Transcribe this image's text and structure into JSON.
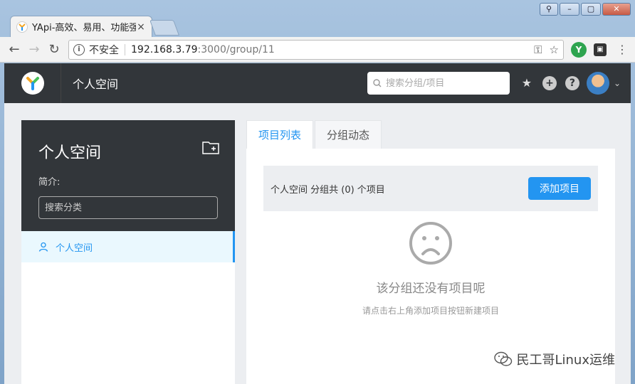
{
  "browser": {
    "tab_title": "YApi-高效、易用、功能强",
    "insecure_label": "不安全",
    "url_host": "192.168.3.79",
    "url_rest": ":3000/group/11",
    "ext_green": "Y"
  },
  "header": {
    "title": "个人空间",
    "search_placeholder": "搜索分组/项目"
  },
  "sidebar": {
    "group_name": "个人空间",
    "intro_label": "简介:",
    "category_search_placeholder": "搜索分类",
    "items": [
      {
        "label": "个人空间"
      }
    ]
  },
  "content": {
    "tabs": [
      {
        "label": "项目列表"
      },
      {
        "label": "分组动态"
      }
    ],
    "summary": "个人空间 分组共 (0) 个项目",
    "add_button": "添加项目",
    "empty_title": "该分组还没有项目呢",
    "empty_hint": "请点击右上角添加项目按钮新建项目"
  },
  "watermark": "民工哥Linux运维",
  "colors": {
    "accent": "#2395f1",
    "header_bg": "#32363a",
    "body_bg": "#eceef1"
  }
}
